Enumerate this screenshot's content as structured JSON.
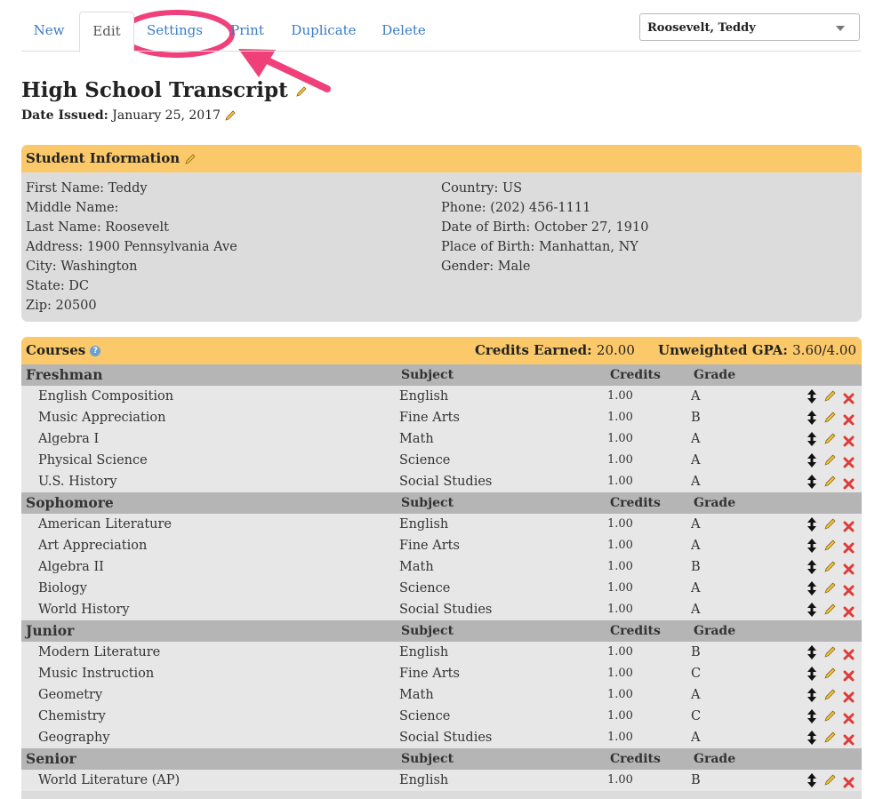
{
  "tabs": [
    "New",
    "Edit",
    "Settings",
    "Print",
    "Duplicate",
    "Delete"
  ],
  "student_select": "Roosevelt, Teddy",
  "page_title": "High School Transcript",
  "date_issued_label": "Date Issued:",
  "date_issued_value": "January 25, 2017",
  "student_info": {
    "title": "Student Information",
    "left": [
      "First Name: Teddy",
      "Middle Name:",
      "Last Name: Roosevelt",
      "Address: 1900 Pennsylvania Ave",
      "City: Washington",
      "State: DC",
      "Zip: 20500"
    ],
    "right": [
      "Country: US",
      "Phone: (202) 456-1111",
      "Date of Birth: October 27, 1910",
      "Place of Birth: Manhattan, NY",
      "Gender: Male"
    ]
  },
  "courses": {
    "title": "Courses",
    "credits_label": "Credits Earned:",
    "credits_value": "20.00",
    "gpa_label": "Unweighted GPA:",
    "gpa_value": "3.60/4.00",
    "col_subject": "Subject",
    "col_credits": "Credits",
    "col_grade": "Grade",
    "years": [
      {
        "name": "Freshman",
        "rows": [
          [
            "English Composition",
            "English",
            "1.00",
            "A"
          ],
          [
            "Music Appreciation",
            "Fine Arts",
            "1.00",
            "B"
          ],
          [
            "Algebra I",
            "Math",
            "1.00",
            "A"
          ],
          [
            "Physical Science",
            "Science",
            "1.00",
            "A"
          ],
          [
            "U.S. History",
            "Social Studies",
            "1.00",
            "A"
          ]
        ]
      },
      {
        "name": "Sophomore",
        "rows": [
          [
            "American Literature",
            "English",
            "1.00",
            "A"
          ],
          [
            "Art Appreciation",
            "Fine Arts",
            "1.00",
            "A"
          ],
          [
            "Algebra II",
            "Math",
            "1.00",
            "B"
          ],
          [
            "Biology",
            "Science",
            "1.00",
            "A"
          ],
          [
            "World History",
            "Social Studies",
            "1.00",
            "A"
          ]
        ]
      },
      {
        "name": "Junior",
        "rows": [
          [
            "Modern Literature",
            "English",
            "1.00",
            "B"
          ],
          [
            "Music Instruction",
            "Fine Arts",
            "1.00",
            "C"
          ],
          [
            "Geometry",
            "Math",
            "1.00",
            "A"
          ],
          [
            "Chemistry",
            "Science",
            "1.00",
            "C"
          ],
          [
            "Geography",
            "Social Studies",
            "1.00",
            "A"
          ]
        ]
      },
      {
        "name": "Senior",
        "rows": [
          [
            "World Literature (AP)",
            "English",
            "1.00",
            "B"
          ]
        ]
      }
    ]
  },
  "colors": {
    "accent": "#3a7bc8",
    "header_bg": "#fbc96a",
    "annotation": "#f0407a"
  }
}
